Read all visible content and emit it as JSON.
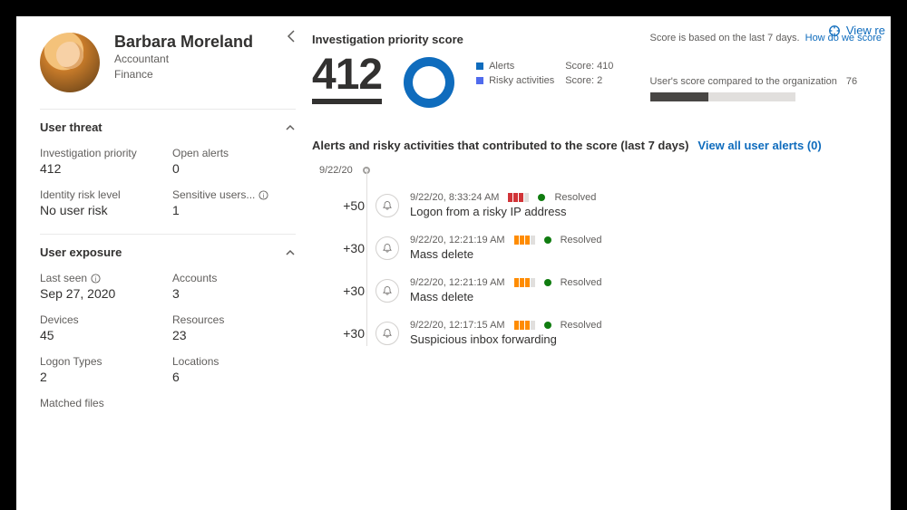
{
  "actionbar": {
    "view_label": "View re"
  },
  "profile": {
    "name": "Barbara Moreland",
    "role": "Accountant",
    "department": "Finance"
  },
  "sections": {
    "user_threat": {
      "title": "User threat",
      "investigation_priority": {
        "label": "Investigation priority",
        "value": "412"
      },
      "open_alerts": {
        "label": "Open alerts",
        "value": "0"
      },
      "identity_risk_level": {
        "label": "Identity risk level",
        "value": "No user risk"
      },
      "sensitive_users": {
        "label": "Sensitive users...",
        "value": "1"
      }
    },
    "user_exposure": {
      "title": "User exposure",
      "last_seen": {
        "label": "Last seen",
        "value": "Sep 27, 2020"
      },
      "accounts": {
        "label": "Accounts",
        "value": "3"
      },
      "devices": {
        "label": "Devices",
        "value": "45"
      },
      "resources": {
        "label": "Resources",
        "value": "23"
      },
      "logon_types": {
        "label": "Logon Types",
        "value": "2"
      },
      "locations": {
        "label": "Locations",
        "value": "6"
      },
      "matched_files": {
        "label": "Matched files"
      }
    }
  },
  "score_panel": {
    "title": "Investigation priority score",
    "score": "412",
    "legend_alerts": "Alerts",
    "legend_activities": "Risky activities",
    "score_alerts": "Score: 410",
    "score_activities": "Score: 2",
    "note": "Score is based on the last 7 days.",
    "help_link": "How do we score",
    "compare_label": "User's score compared to the organization",
    "compare_value": "76"
  },
  "alerts_panel": {
    "heading": "Alerts and risky activities that contributed to the score (last 7 days)",
    "view_all": "View all user alerts (0)",
    "date_group": "9/22/20",
    "items": [
      {
        "delta": "+50",
        "time": "9/22/20, 8:33:24 AM",
        "severity": "high",
        "status": "Resolved",
        "title": "Logon from a risky IP address"
      },
      {
        "delta": "+30",
        "time": "9/22/20, 12:21:19 AM",
        "severity": "med",
        "status": "Resolved",
        "title": "Mass delete"
      },
      {
        "delta": "+30",
        "time": "9/22/20, 12:21:19 AM",
        "severity": "med",
        "status": "Resolved",
        "title": "Mass delete"
      },
      {
        "delta": "+30",
        "time": "9/22/20, 12:17:15 AM",
        "severity": "med",
        "status": "Resolved",
        "title": "Suspicious inbox forwarding"
      }
    ]
  },
  "colors": {
    "accent": "#0f6cbd"
  }
}
